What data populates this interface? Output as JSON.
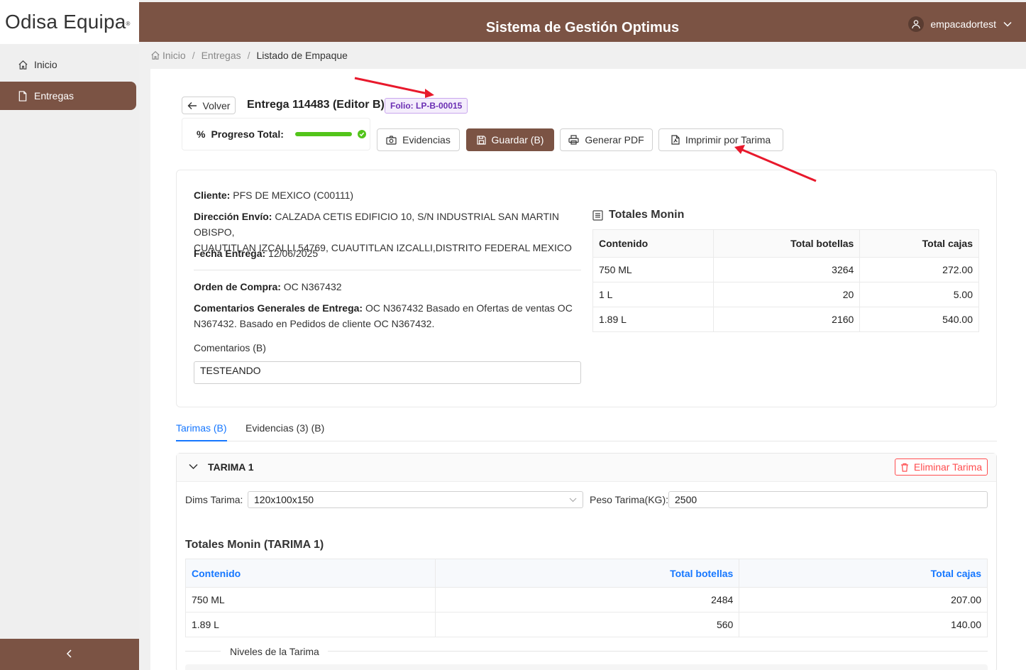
{
  "sidebar": {
    "logo": "Odisa Equipa",
    "logo_mark": "®",
    "items": [
      {
        "label": "Inicio",
        "icon": "home-icon"
      },
      {
        "label": "Entregas",
        "icon": "file-icon"
      }
    ]
  },
  "header": {
    "title": "Sistema de Gestión Optimus",
    "user": "empacadortest"
  },
  "breadcrumb": {
    "items": [
      "Inicio",
      "Entregas",
      "Listado de Empaque"
    ],
    "sep": "/"
  },
  "toolbar": {
    "back_label": "Volver",
    "title": "Entrega 114483 (Editor B)",
    "folio": "Folio: LP-B-00015",
    "progress_label": "Progreso Total:",
    "progress_value": 100,
    "evidencias_label": "Evidencias",
    "save_label": "Guardar (B)",
    "pdf_label": "Generar PDF",
    "print_label": "Imprimir por Tarima"
  },
  "info": {
    "cliente_label": "Cliente:",
    "cliente": "PFS DE MEXICO (C00111)",
    "direccion_label": "Dirección Envío:",
    "direccion_1": "CALZADA CETIS EDIFICIO 10, S/N INDUSTRIAL SAN MARTIN OBISPO,",
    "direccion_2": "CUAUTITLAN IZCALLI 54769, CUAUTITLAN IZCALLI,DISTRITO FEDERAL MEXICO",
    "fecha_label": "Fecha Entrega:",
    "fecha": "12/06/2025",
    "orden_label": "Orden de Compra:",
    "orden": "OC N367432",
    "coment_label": "Comentarios Generales de Entrega:",
    "coment_1": "OC N367432 Basado en Ofertas de ventas OC",
    "coment_2": "N367432. Basado en Pedidos de cliente OC N367432.",
    "coment_b_label": "Comentarios (B)",
    "coment_b_value": "TESTEANDO"
  },
  "totales": {
    "title": "Totales Monin",
    "headers": [
      "Contenido",
      "Total botellas",
      "Total cajas"
    ],
    "rows": [
      [
        "750 ML",
        "3264",
        "272.00"
      ],
      [
        "1 L",
        "20",
        "5.00"
      ],
      [
        "1.89 L",
        "2160",
        "540.00"
      ]
    ]
  },
  "tabs": [
    {
      "label": "Tarimas (B)"
    },
    {
      "label": "Evidencias (3) (B)"
    }
  ],
  "pallet": {
    "name": "TARIMA 1",
    "delete_label": "Eliminar Tarima",
    "dims_label": "Dims Tarima",
    "dims_value": "120x100x150",
    "peso_label": "Peso Tarima(KG)",
    "peso_value": "2500",
    "totals_title": "Totales Monin (TARIMA 1)",
    "headers": [
      "Contenido",
      "Total botellas",
      "Total cajas"
    ],
    "rows": [
      [
        "750 ML",
        "2484",
        "207.00"
      ],
      [
        "1.89 L",
        "560",
        "140.00"
      ]
    ],
    "niveles_label": "Niveles de la Tarima"
  },
  "colors": {
    "brand": "#7b5344",
    "accent": "#1677ff",
    "success": "#52c41a",
    "danger": "#ff4d4f",
    "annotation_arrow": "#e8192c"
  }
}
